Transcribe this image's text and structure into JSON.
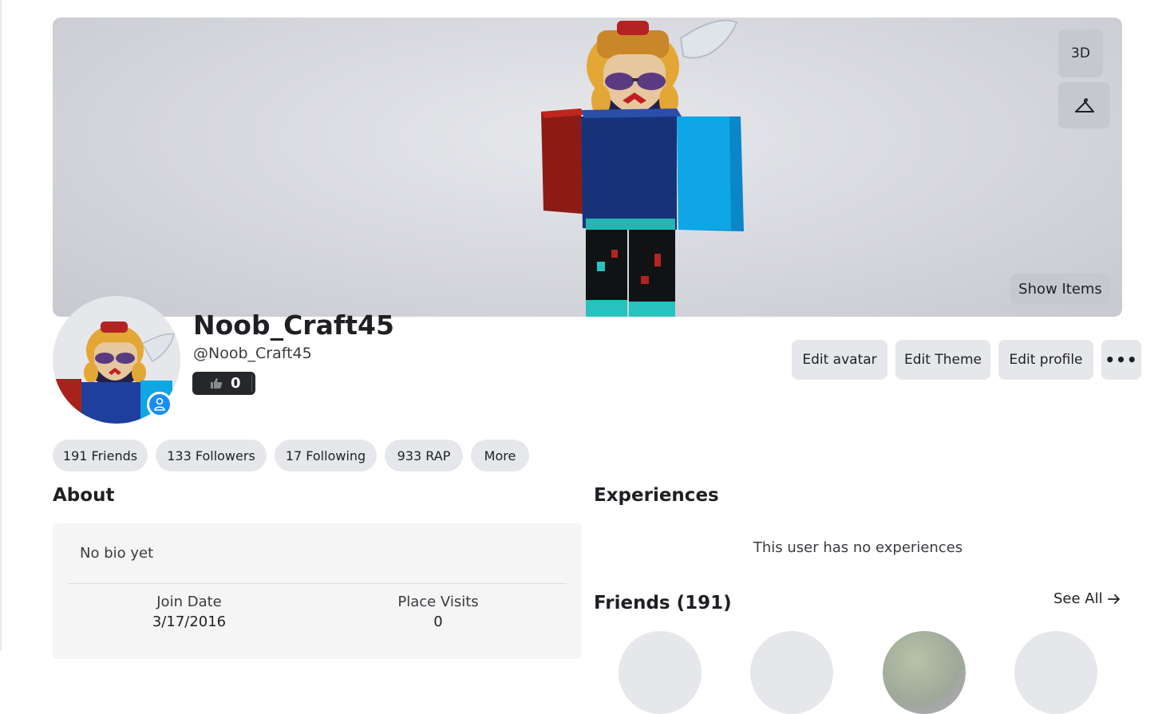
{
  "hero": {
    "view_3d_label": "3D",
    "outfit_icon": "hanger-icon",
    "show_items_label": "Show Items"
  },
  "profile": {
    "display_name": "Noob_Craft45",
    "username": "@Noob_Craft45",
    "like_count": "0",
    "badge_icon": "person-icon"
  },
  "actions": {
    "edit_avatar": "Edit avatar",
    "edit_theme": "Edit Theme",
    "edit_profile": "Edit profile",
    "more": "•••"
  },
  "stats": {
    "friends": "191 Friends",
    "followers": "133 Followers",
    "following": "17 Following",
    "rap": "933 RAP",
    "more": "More"
  },
  "about": {
    "title": "About",
    "bio": "No bio yet",
    "join_date_label": "Join Date",
    "join_date_value": "3/17/2016",
    "place_visits_label": "Place Visits",
    "place_visits_value": "0"
  },
  "experiences": {
    "title": "Experiences",
    "empty_message": "This user has no experiences"
  },
  "friends": {
    "title": "Friends (191)",
    "see_all": "See All"
  },
  "colors": {
    "accent_blue": "#1b8cf5",
    "chip_bg": "#e6e7ea",
    "like_pill_bg": "#26272b"
  }
}
